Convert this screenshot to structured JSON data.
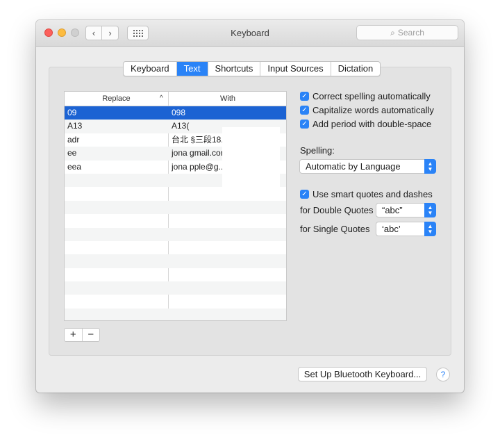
{
  "window": {
    "title": "Keyboard"
  },
  "toolbar": {
    "back_icon": "‹",
    "forward_icon": "›",
    "search_placeholder": "Search",
    "search_icon": "⌕"
  },
  "tabs": [
    {
      "label": "Keyboard",
      "active": false
    },
    {
      "label": "Text",
      "active": true
    },
    {
      "label": "Shortcuts",
      "active": false
    },
    {
      "label": "Input Sources",
      "active": false
    },
    {
      "label": "Dictation",
      "active": false
    }
  ],
  "table": {
    "headers": {
      "replace": "Replace",
      "with": "With"
    },
    "sort_indicator": "^",
    "rows": [
      {
        "replace": "09",
        "with": "098",
        "selected": true
      },
      {
        "replace": "A13",
        "with": "A13("
      },
      {
        "replace": "adr",
        "with": "台北                      §三段18..."
      },
      {
        "replace": "ee",
        "with": "jona                    ɡmail.com"
      },
      {
        "replace": "eea",
        "with": "jona                    pple@g..."
      },
      {
        "replace": "",
        "with": ""
      },
      {
        "replace": "",
        "with": ""
      },
      {
        "replace": "",
        "with": ""
      },
      {
        "replace": "",
        "with": ""
      },
      {
        "replace": "",
        "with": ""
      },
      {
        "replace": "",
        "with": ""
      },
      {
        "replace": "",
        "with": ""
      },
      {
        "replace": "",
        "with": ""
      },
      {
        "replace": "",
        "with": ""
      },
      {
        "replace": "",
        "with": ""
      },
      {
        "replace": "",
        "with": ""
      }
    ],
    "add_label": "+",
    "remove_label": "−"
  },
  "options": {
    "correct_spelling": "Correct spelling automatically",
    "capitalize_words": "Capitalize words automatically",
    "add_period": "Add period with double-space",
    "spelling_label": "Spelling:",
    "spelling_value": "Automatic by Language",
    "smart_quotes": "Use smart quotes and dashes",
    "double_quotes_label": "for Double Quotes",
    "double_quotes_value": "“abc”",
    "single_quotes_label": "for Single Quotes",
    "single_quotes_value": "‘abc’",
    "checked_glyph": "✓"
  },
  "footer": {
    "bluetooth_button": "Set Up Bluetooth Keyboard...",
    "help": "?"
  },
  "colors": {
    "accent": "#2a83f7",
    "selection": "#1c63d3"
  }
}
